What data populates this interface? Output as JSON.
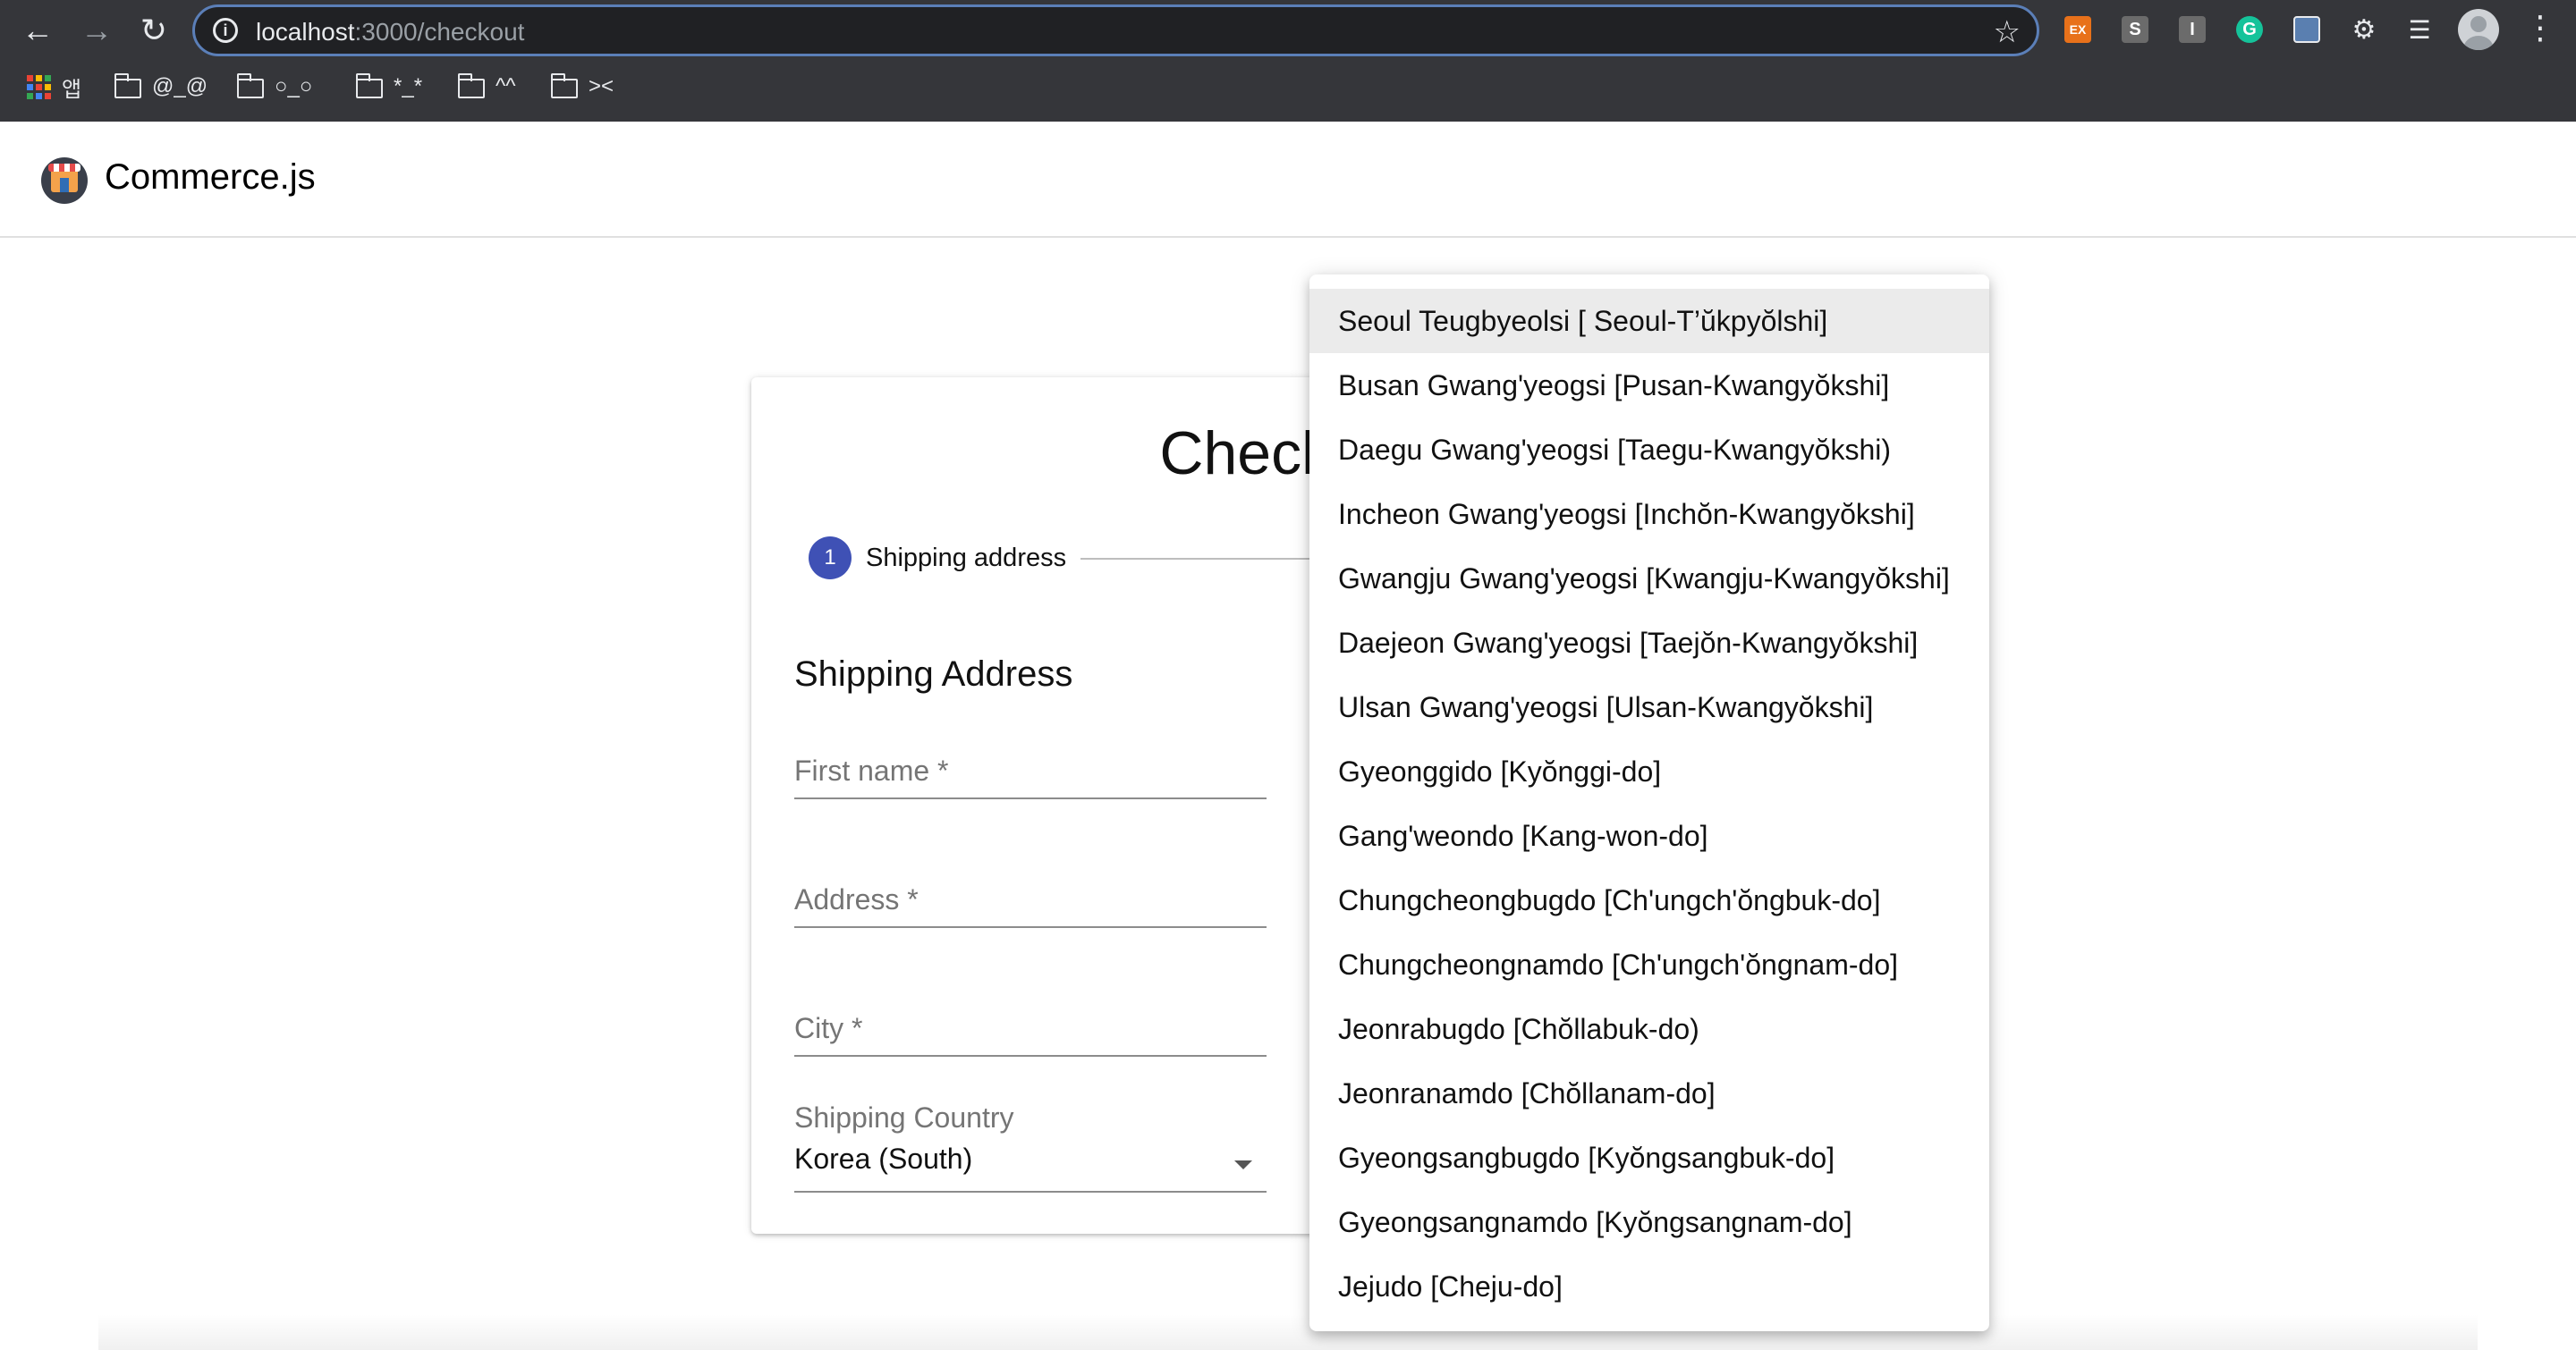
{
  "browser": {
    "url_host": "localhost",
    "url_path": ":3000/checkout",
    "bookmarks": [
      {
        "label": "앱",
        "icon": "apps-grid-icon"
      },
      {
        "label": "@_@",
        "icon": "folder-icon"
      },
      {
        "label": "○_○",
        "icon": "folder-icon"
      },
      {
        "label": "*_*",
        "icon": "folder-icon"
      },
      {
        "label": "^^",
        "icon": "folder-icon"
      },
      {
        "label": "><",
        "icon": "folder-icon"
      }
    ],
    "extensions": [
      {
        "label": "EX",
        "icon": "ex-extension-icon",
        "color": "#e8711a"
      },
      {
        "label": "S",
        "icon": "s-extension-icon",
        "color": "#6b6b6b"
      },
      {
        "label": "I",
        "icon": "i-extension-icon",
        "color": "#6b6b6b"
      },
      {
        "label": "G",
        "icon": "grammarly-icon",
        "color": "#15c39a"
      }
    ]
  },
  "header": {
    "brand": "Commerce.js"
  },
  "checkout": {
    "title": "Checkout",
    "step_number": "1",
    "step_label": "Shipping address",
    "section_title": "Shipping Address",
    "fields": {
      "first_name": "First name *",
      "address": "Address *",
      "city": "City *"
    },
    "shipping_country": {
      "label": "Shipping Country",
      "value": "Korea (South)"
    }
  },
  "subdivision_menu": {
    "selected_index": 0,
    "options": [
      "Seoul Teugbyeolsi [ Seoul-T’ŭkpyŏlshi]",
      "Busan Gwang'yeogsi [Pusan-Kwangyŏkshi]",
      "Daegu Gwang'yeogsi [Taegu-Kwangyŏkshi)",
      "Incheon Gwang'yeogsi [Inchŏn-Kwangyŏkshi]",
      "Gwangju Gwang'yeogsi [Kwangju-Kwangyŏkshi]",
      "Daejeon Gwang'yeogsi [Taejŏn-Kwangyŏkshi]",
      "Ulsan Gwang'yeogsi [Ulsan-Kwangyŏkshi]",
      "Gyeonggido [Kyŏnggi-do]",
      "Gang'weondo [Kang-won-do]",
      "Chungcheongbugdo [Ch'ungch'ŏngbuk-do]",
      "Chungcheongnamdo [Ch'ungch'ŏngnam-do]",
      "Jeonrabugdo [Chŏllabuk-do)",
      "Jeonranamdo [Chŏllanam-do]",
      "Gyeongsangbugdo [Kyŏngsangbuk-do]",
      "Gyeongsangnamdo [Kyŏngsangnam-do]",
      "Jejudo [Cheju-do]"
    ]
  },
  "colors": {
    "accent": "#3f51b5",
    "chrome_bg": "#35363a"
  }
}
